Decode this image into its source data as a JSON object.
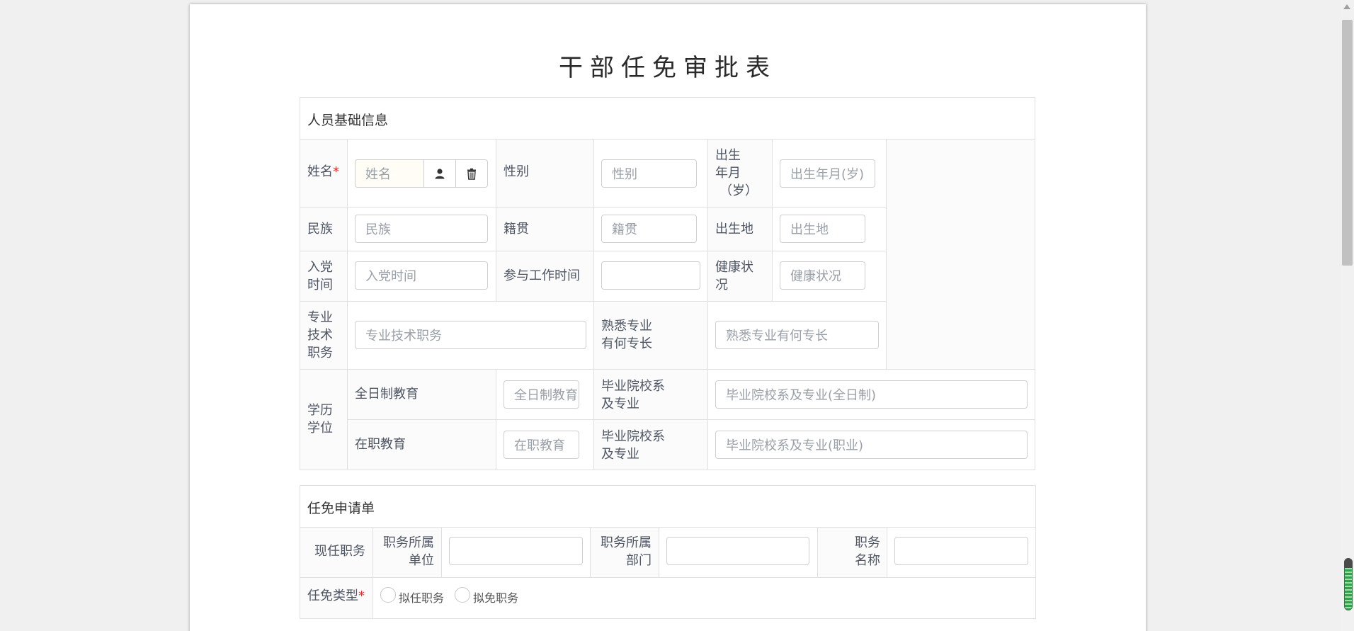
{
  "title": "干部任免审批表",
  "section1": {
    "heading": "人员基础信息",
    "name_label": "姓名",
    "name_placeholder": "姓名",
    "gender_label": "性别",
    "gender_placeholder": "性别",
    "birth_label": "出生年月（岁）",
    "birth_label_l1": "出生",
    "birth_label_l2": "年月",
    "birth_label_l3": "（岁）",
    "birth_placeholder": "出生年月(岁)",
    "ethnicity_label": "民族",
    "ethnicity_placeholder": "民族",
    "native_label": "籍贯",
    "native_placeholder": "籍贯",
    "birthplace_label": "出生地",
    "birthplace_placeholder": "出生地",
    "party_label_l1": "入党",
    "party_label_l2": "时间",
    "party_placeholder": "入党时间",
    "work_label": "参与工作时间",
    "work_value": "",
    "health_label_l1": "健康状",
    "health_label_l2": "况",
    "health_placeholder": "健康状况",
    "tech_label_l1": "专业",
    "tech_label_l2": "技术",
    "tech_label_l3": "职务",
    "tech_placeholder": "专业技术职务",
    "specialty_label_l1": "熟悉专业",
    "specialty_label_l2": "有何专长",
    "specialty_placeholder": "熟悉专业有何专长",
    "degree_label_l1": "学历",
    "degree_label_l2": "学位",
    "fulltime_label": "全日制教育",
    "fulltime_placeholder": "全日制教育",
    "fulltime_school_label_l1": "毕业院校系",
    "fulltime_school_label_l2": "及专业",
    "fulltime_school_placeholder": "毕业院校系及专业(全日制)",
    "parttime_label": "在职教育",
    "parttime_placeholder": "在职教育",
    "parttime_school_label_l1": "毕业院校系",
    "parttime_school_label_l2": "及专业",
    "parttime_school_placeholder": "毕业院校系及专业(职业)"
  },
  "section2": {
    "heading": "任免申请单",
    "current_post_label": "现任职务",
    "unit_label_l1": "职务所属",
    "unit_label_l2": "单位",
    "dept_label_l1": "职务所属",
    "dept_label_l2": "部门",
    "post_name_label_l1": "职务",
    "post_name_label_l2": "名称",
    "type_label": "任免类型",
    "option_appoint": "拟任职务",
    "option_remove": "拟免职务"
  },
  "icons": {
    "person": "person-icon",
    "trash": "trash-icon"
  },
  "colors": {
    "required": "#e03030",
    "border": "#e0e0e0"
  }
}
